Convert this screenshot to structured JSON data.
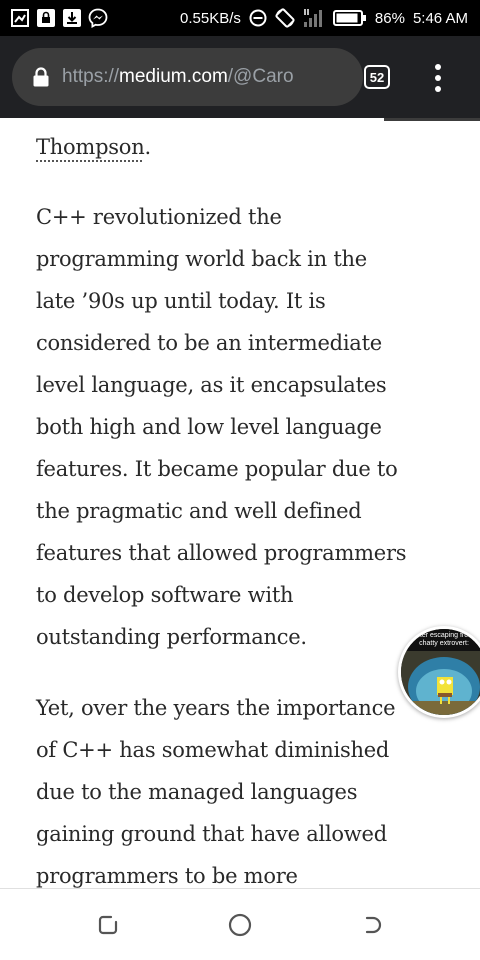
{
  "status_bar": {
    "speed": "0.55KB/s",
    "battery_percent": "86%",
    "time": "5:46 AM",
    "icons": [
      "screenshot-icon",
      "lock-notification-icon",
      "download-icon",
      "messenger-icon",
      "dnd-icon",
      "rotate-icon",
      "signal-icon",
      "battery-icon"
    ]
  },
  "browser": {
    "url_scheme": "https://",
    "url_host": "medium.com",
    "url_path": "/@Caro",
    "tab_count": "52",
    "page_progress": 0.8,
    "colors": {
      "toolbar": "#202124",
      "pill": "#3c3c3c"
    }
  },
  "article": {
    "top_line_word": "Thompson",
    "top_line_period": ".",
    "p1_lines": [
      "C++ revolutionized the",
      "programming world back in the",
      "late ’90s up until today. It is",
      "considered to be an intermediate",
      "level language, as it encapsulates",
      "both high and low level language",
      "features. It became popular due to",
      "the pragmatic and well defined",
      "features that allowed programmers",
      "to develop software with",
      "outstanding performance."
    ],
    "p2_lines": [
      "Yet, over the years the importance",
      "of C++ has somewhat diminished",
      "due to the managed languages",
      "gaining ground that have allowed",
      "programmers to be more"
    ]
  },
  "bubble": {
    "caption_line1": "after escaping from",
    "caption_line2": "chatty extrovert:"
  },
  "nav": {
    "icons": [
      "recent-apps-icon",
      "home-icon",
      "back-icon"
    ]
  }
}
